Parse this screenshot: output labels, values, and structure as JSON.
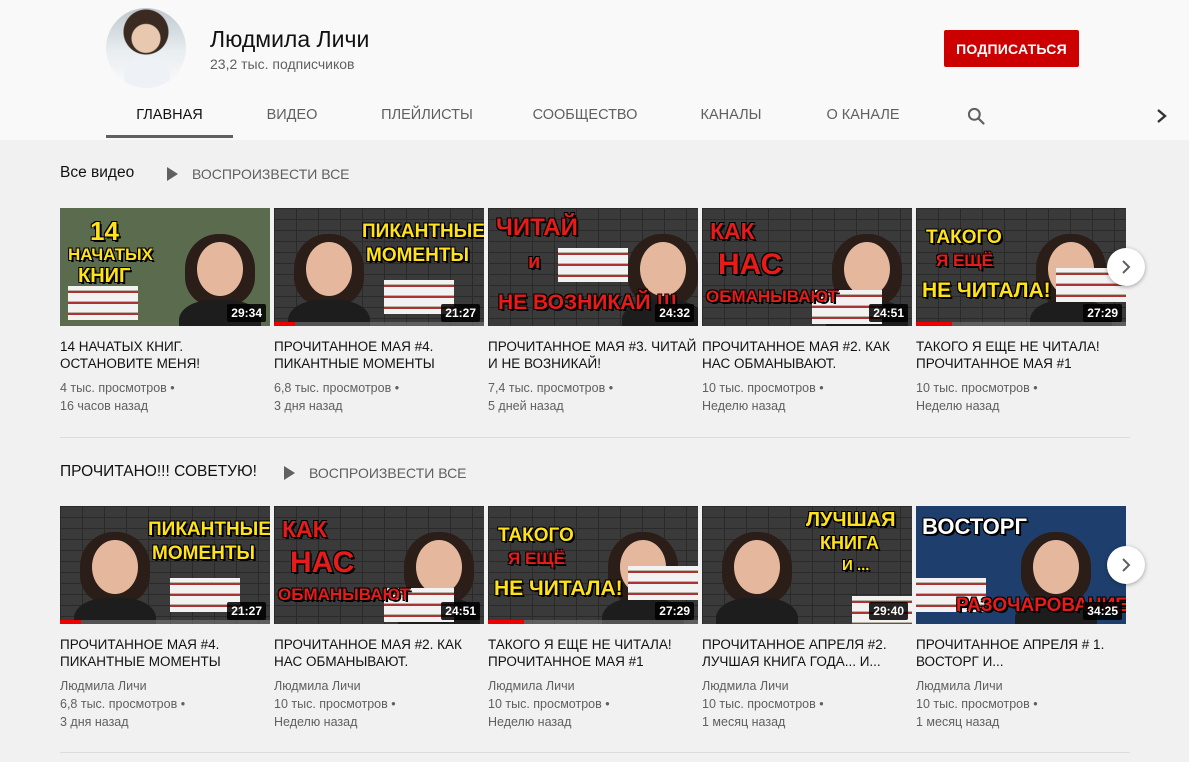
{
  "channel": {
    "name": "Людмила Личи",
    "subscribers": "23,2 тыс. подписчиков",
    "subscribe_label": "ПОДПИСАТЬСЯ"
  },
  "tabs": [
    "ГЛАВНАЯ",
    "ВИДЕО",
    "ПЛЕЙЛИСТЫ",
    "СООБЩЕСТВО",
    "КАНАЛЫ",
    "О КАНАЛЕ"
  ],
  "sections": [
    {
      "title": "Все видео",
      "play_all": "ВОСПРОИЗВЕСТИ ВСЕ",
      "videos": [
        {
          "title": "14 НАЧАТЫХ КНИГ. ОСТАНОВИТЕ МЕНЯ!",
          "duration": "29:34",
          "views": "4 тыс. просмотров •",
          "age": "16 часов назад",
          "thumb_text": [
            "14",
            "НАЧАТЫХ",
            "КНИГ"
          ],
          "progress": 0
        },
        {
          "title": "ПРОЧИТАННОЕ МАЯ #4. ПИКАНТНЫЕ МОМЕНТЫ",
          "duration": "21:27",
          "views": "6,8 тыс. просмотров •",
          "age": "3 дня назад",
          "thumb_text": [
            "ПИКАНТНЫЕ",
            "МОМЕНТЫ"
          ],
          "progress": 0.1
        },
        {
          "title": "ПРОЧИТАННОЕ МАЯ #3. ЧИТАЙ И НЕ ВОЗНИКАЙ!",
          "duration": "24:32",
          "views": "7,4 тыс. просмотров •",
          "age": "5 дней назад",
          "thumb_text": [
            "ЧИТАЙ",
            "и",
            "НЕ ВОЗНИКАЙ !!!"
          ],
          "progress": 0
        },
        {
          "title": "ПРОЧИТАННОЕ МАЯ #2. КАК НАС ОБМАНЫВАЮТ.",
          "duration": "24:51",
          "views": "10 тыс. просмотров •",
          "age": "Неделю назад",
          "thumb_text": [
            "КАК",
            "НАС",
            "ОБМАНЫВАЮТ"
          ],
          "progress": 0
        },
        {
          "title": "ТАКОГО Я ЕЩЕ НЕ ЧИТАЛА! ПРОЧИТАННОЕ МАЯ #1",
          "duration": "27:29",
          "views": "10 тыс. просмотров •",
          "age": "Неделю назад",
          "thumb_text": [
            "ТАКОГО",
            "Я ЕЩЁ",
            "НЕ ЧИТАЛА!"
          ],
          "progress": 0.17
        }
      ]
    },
    {
      "title": "ПРОЧИТАНО!!! СОВЕТУЮ!",
      "play_all": "ВОСПРОИЗВЕСТИ ВСЕ",
      "videos": [
        {
          "title": "ПРОЧИТАННОЕ МАЯ #4. ПИКАНТНЫЕ МОМЕНТЫ",
          "author": "Людмила Личи",
          "duration": "21:27",
          "views": "6,8 тыс. просмотров •",
          "age": "3 дня назад",
          "thumb_text": [
            "ПИКАНТНЫЕ",
            "МОМЕНТЫ"
          ],
          "progress": 0.1
        },
        {
          "title": "ПРОЧИТАННОЕ МАЯ #2. КАК НАС ОБМАНЫВАЮТ.",
          "author": "Людмила Личи",
          "duration": "24:51",
          "views": "10 тыс. просмотров •",
          "age": "Неделю назад",
          "thumb_text": [
            "КАК",
            "НАС",
            "ОБМАНЫВАЮТ"
          ],
          "progress": 0
        },
        {
          "title": "ТАКОГО Я ЕЩЕ НЕ ЧИТАЛА! ПРОЧИТАННОЕ МАЯ #1",
          "author": "Людмила Личи",
          "duration": "27:29",
          "views": "10 тыс. просмотров •",
          "age": "Неделю назад",
          "thumb_text": [
            "ТАКОГО",
            "Я ЕЩЁ",
            "НЕ ЧИТАЛА!"
          ],
          "progress": 0.17
        },
        {
          "title": "ПРОЧИТАННОЕ АПРЕЛЯ #2. ЛУЧШАЯ КНИГА ГОДА... И...",
          "author": "Людмила Личи",
          "duration": "29:40",
          "views": "10 тыс. просмотров •",
          "age": "1 месяц назад",
          "thumb_text": [
            "ЛУЧШАЯ",
            "КНИГА",
            "И ..."
          ],
          "progress": 0
        },
        {
          "title": "ПРОЧИТАННОЕ АПРЕЛЯ # 1. ВОСТОРГ И...",
          "author": "Людмила Личи",
          "duration": "34:25",
          "views": "10 тыс. просмотров •",
          "age": "1 месяц назад",
          "thumb_text": [
            "ВОСТОРГ",
            "РАЗОЧАРОВАНИЕ"
          ],
          "progress": 0
        }
      ]
    }
  ],
  "icons": {
    "search": "search-icon",
    "tabs_next": "chevron-right-icon",
    "shelf_next": "chevron-right-icon",
    "play": "play-icon"
  },
  "colors": {
    "subscribe": "#cc0000",
    "progress": "#e00000",
    "thumb_yellow": "#ffe21a",
    "thumb_red": "#e81b1b"
  }
}
